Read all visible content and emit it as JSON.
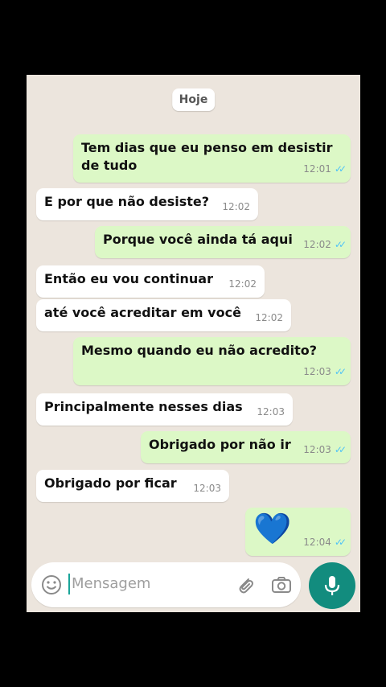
{
  "chat": {
    "date_label": "Hoje",
    "messages": [
      {
        "dir": "out",
        "lines": [
          "Tem dias que eu penso em desistir",
          "de tudo"
        ],
        "time": "12:01",
        "read": true
      },
      {
        "dir": "in",
        "lines": [
          "E por que não desiste?"
        ],
        "time": "12:02"
      },
      {
        "dir": "out",
        "lines": [
          "Porque você ainda tá aqui"
        ],
        "time": "12:02",
        "read": true
      },
      {
        "dir": "in",
        "lines": [
          "Então eu vou continuar"
        ],
        "time": "12:02"
      },
      {
        "dir": "in",
        "lines": [
          "até você acreditar em você"
        ],
        "time": "12:02"
      },
      {
        "dir": "out",
        "lines": [
          "Mesmo quando eu não acredito?"
        ],
        "time": "12:03",
        "read": true
      },
      {
        "dir": "in",
        "lines": [
          "Principalmente nesses dias"
        ],
        "time": "12:03"
      },
      {
        "dir": "out",
        "lines": [
          "Obrigado por não ir"
        ],
        "time": "12:03",
        "read": true
      },
      {
        "dir": "in",
        "lines": [
          "Obrigado por ficar"
        ],
        "time": "12:03"
      },
      {
        "dir": "out",
        "emoji": "💙",
        "time": "12:04",
        "read": true
      }
    ]
  },
  "composer": {
    "placeholder": "Mensagem",
    "icons": [
      "emoji-icon",
      "attach-icon",
      "camera-icon",
      "mic-icon"
    ]
  },
  "colors": {
    "background": "#ece5dd",
    "outgoing": "#dcf8c6",
    "incoming": "#ffffff",
    "tick_read": "#4fc3f7",
    "mic": "#128c7e"
  }
}
